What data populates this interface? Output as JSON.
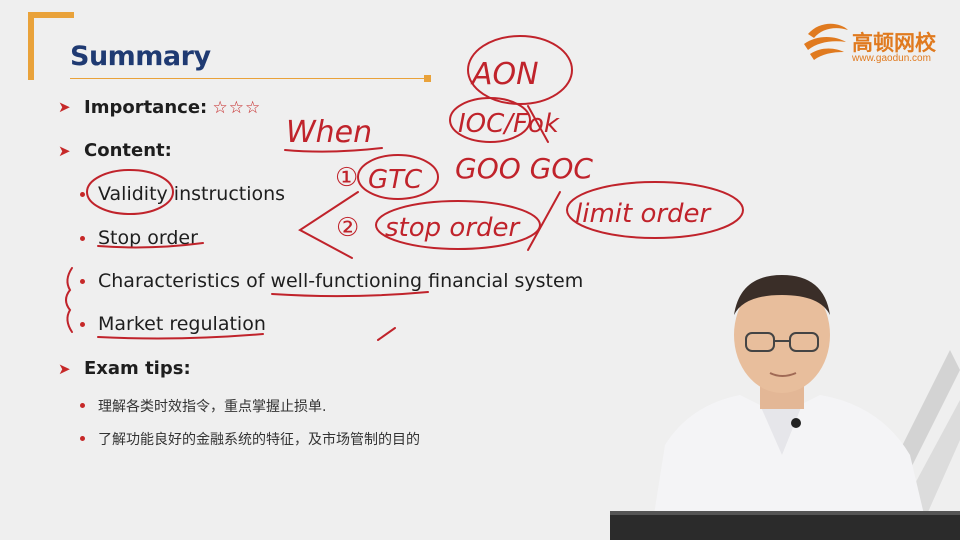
{
  "slide": {
    "title": "Summary",
    "importance_label": "Importance:",
    "importance_stars": "☆☆☆",
    "content_label": "Content:",
    "content_items": [
      "Validity instructions",
      "Stop order",
      "Characteristics of well-functioning financial system",
      "Market regulation"
    ],
    "exam_tips_label": "Exam tips:",
    "exam_tips": [
      "理解各类时效指令，重点掌握止损单.",
      "了解功能良好的金融系统的特征，及市场管制的目的"
    ]
  },
  "logo": {
    "name": "高顿网校",
    "url": "www.gaodun.com"
  },
  "handwriting": {
    "aon": "AON",
    "ioc_fok": "IOC/Fok",
    "when": "When",
    "circle_one": "①",
    "gtc": "GTC",
    "goo_goc": "GOO GOC",
    "circle_two": "②",
    "stop_order": "stop order",
    "limit_order": "limit order"
  },
  "colors": {
    "accent_orange": "#e9a23a",
    "title_navy": "#1f3a72",
    "bullet_red": "#c62828",
    "ink_red": "#c0232b"
  }
}
